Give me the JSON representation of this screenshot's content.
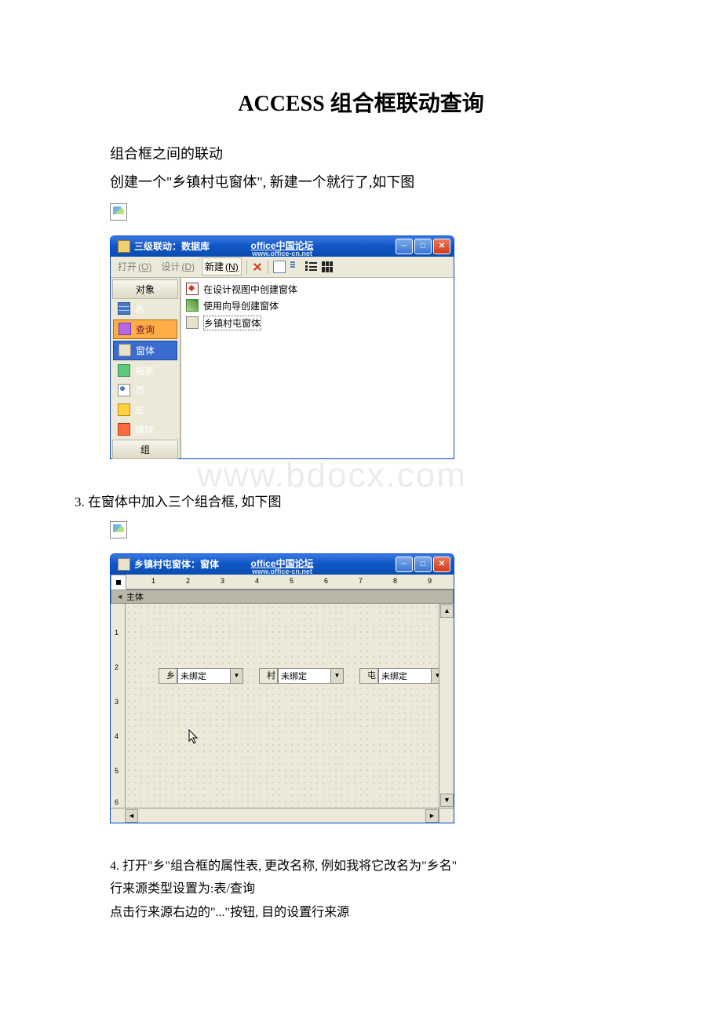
{
  "title": "ACCESS 组合框联动查询",
  "paragraphs": {
    "p1": "组合框之间的联动",
    "p2": "创建一个\"乡镇村屯窗体\", 新建一个就行了,如下图",
    "p3": "3. 在窗体中加入三个组合框, 如下图",
    "p4": "4. 打开\"乡\"组合框的属性表, 更改名称, 例如我将它改名为\"乡名\"",
    "p5": "行来源类型设置为:表/查询",
    "p6": "点击行来源右边的\"...\"按钮, 目的设置行来源"
  },
  "watermark": "www.bdocx.com",
  "forum": {
    "name": "office中国论坛",
    "url": "www.office-cn.net"
  },
  "win_buttons": {
    "min": "─",
    "max": "□",
    "close": "✕"
  },
  "db_window": {
    "title": "三级联动：数据库",
    "toolbar": {
      "open": "打开",
      "open_key": "(O)",
      "design": "设计",
      "design_key": "(D)",
      "new": "新建",
      "new_key": "(N)"
    },
    "sidebar": {
      "header": "对象",
      "items": [
        "表",
        "查询",
        "窗体",
        "报表",
        "页",
        "宏",
        "模块"
      ],
      "group_header": "组"
    },
    "list": {
      "item1": "在设计视图中创建窗体",
      "item2": "使用向导创建窗体",
      "item3": "乡镇村屯窗体"
    }
  },
  "form_window": {
    "title": "乡镇村屯窗体：窗体",
    "section": "主体",
    "ruler_h": [
      "1",
      "2",
      "3",
      "4",
      "5",
      "6",
      "7",
      "8",
      "9"
    ],
    "ruler_v": [
      "1",
      "2",
      "3",
      "4",
      "5",
      "6"
    ],
    "combos": [
      {
        "label": "乡",
        "value": "未绑定"
      },
      {
        "label": "村",
        "value": "未绑定"
      },
      {
        "label": "屯",
        "value": "未绑定"
      }
    ],
    "scroll": {
      "up": "▲",
      "down": "▼",
      "left": "◄",
      "right": "►"
    }
  }
}
